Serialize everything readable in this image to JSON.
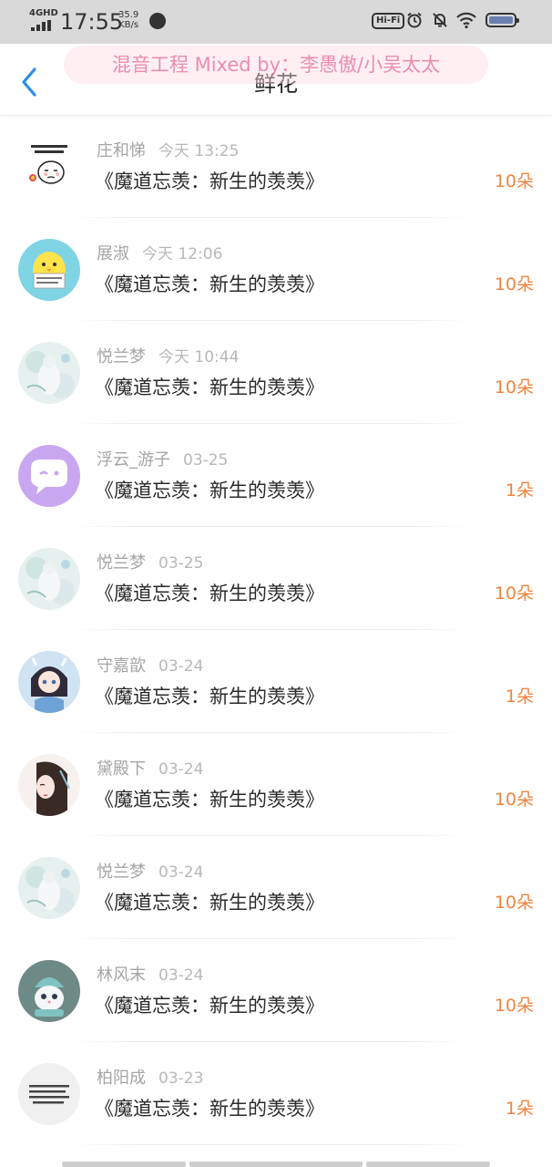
{
  "status_bar": {
    "network": "4GHD",
    "time": "17:55",
    "speed_value": "35.9",
    "speed_unit": "KB/s",
    "hifi": "Hi-Fi",
    "battery_color": "#6a7fb0"
  },
  "header": {
    "title": "鲜花",
    "overlay_banner": "混音工程 Mixed by：李愚傲/小吴太太",
    "back_icon": "chevron-left-icon",
    "accent_color": "#2b8de8"
  },
  "colors": {
    "count": "#f0843f",
    "name": "#a5a5a5"
  },
  "rows": [
    {
      "name": "庄和悌",
      "time": "今天 13:25",
      "title": "《魔道忘羡：新生的羡羡》",
      "count": "10朵",
      "avatar": "meme"
    },
    {
      "name": "展淑",
      "time": "今天 12:06",
      "title": "《魔道忘羡：新生的羡羡》",
      "count": "10朵",
      "avatar": "chick"
    },
    {
      "name": "悦兰梦",
      "time": "今天 10:44",
      "title": "《魔道忘羡：新生的羡羡》",
      "count": "10朵",
      "avatar": "flower"
    },
    {
      "name": "浮云_游子",
      "time": "03-25",
      "title": "《魔道忘羡：新生的羡羡》",
      "count": "1朵",
      "avatar": "chat"
    },
    {
      "name": "悦兰梦",
      "time": "03-25",
      "title": "《魔道忘羡：新生的羡羡》",
      "count": "10朵",
      "avatar": "flower"
    },
    {
      "name": "守嘉歆",
      "time": "03-24",
      "title": "《魔道忘羡：新生的羡羡》",
      "count": "1朵",
      "avatar": "chibi"
    },
    {
      "name": "黛殿下",
      "time": "03-24",
      "title": "《魔道忘羡：新生的羡羡》",
      "count": "10朵",
      "avatar": "lady"
    },
    {
      "name": "悦兰梦",
      "time": "03-24",
      "title": "《魔道忘羡：新生的羡羡》",
      "count": "10朵",
      "avatar": "flower"
    },
    {
      "name": "林风末",
      "time": "03-24",
      "title": "《魔道忘羡：新生的羡羡》",
      "count": "10朵",
      "avatar": "cat"
    },
    {
      "name": "柏阳成",
      "time": "03-23",
      "title": "《魔道忘羡：新生的羡羡》",
      "count": "1朵",
      "avatar": "text"
    }
  ]
}
